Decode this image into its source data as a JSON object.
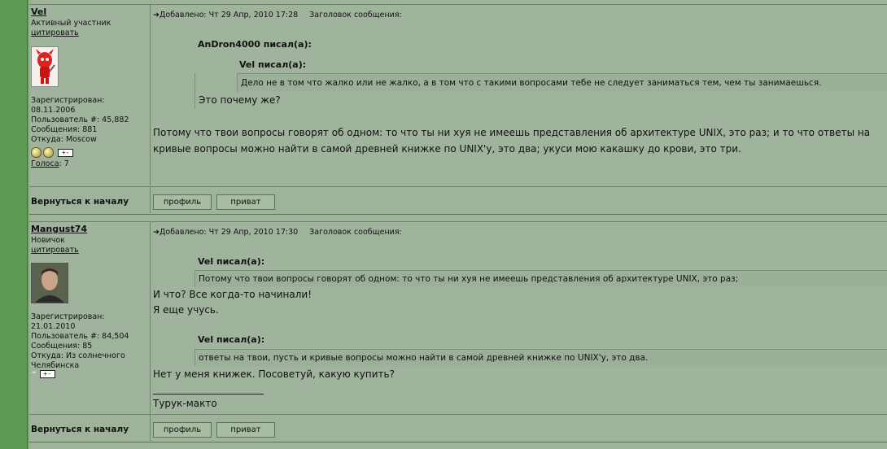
{
  "posts": [
    {
      "author": "Vel",
      "rank": "Активный участник",
      "quote_link": "цитировать",
      "registered_label": "Зарегистрирован:",
      "registered_date": "08.11.2006",
      "user_no": "Пользователь #: 45,882",
      "messages": "Сообщения: 881",
      "from": "Откуда: Moscow",
      "votes_label": "Голоса",
      "votes_value": ": 7",
      "header_added": "Добавлено: Чт 29 Апр, 2010 17:28",
      "header_subject": "Заголовок сообщения:",
      "quote1_author": "AnDron4000 писал(а):",
      "quote2_author": "Vel писал(а):",
      "quote2_text": "Дело не в том что жалко или не жалко, а в том что с такими вопросами тебе не следует заниматься тем, чем ты занимаешься.",
      "quote1_text": "Это почему же?",
      "text_line1": "Потому что твои вопросы говорят об одном: то что ты ни хуя не имеешь представления об архитектуре UNIX, это раз; и то что ответы на",
      "text_line2": "кривые вопросы можно найти в самой древней книжке по UNIX'у, это два; укуси мою какашку до крови, это три."
    },
    {
      "author": "Mangust74",
      "rank": "Новичок",
      "quote_link": "цитировать",
      "registered_label": "Зарегистрирован:",
      "registered_date": "21.01.2010",
      "user_no": "Пользователь #: 84,504",
      "messages": "Сообщения: 85",
      "from": "Откуда: Из солнечного",
      "from2": "Челябинска",
      "header_added": "Добавлено: Чт 29 Апр, 2010 17:30",
      "header_subject": "Заголовок сообщения:",
      "quote1_author": "Vel писал(а):",
      "quote1_text": "Потому что твои вопросы говорят об одном: то что ты ни хуя не имеешь представления об архитектуре UNIX, это раз;",
      "text1": "И что? Все когда-то начинали!",
      "text2": "Я еще учусь.",
      "quote2_author": "Vel писал(а):",
      "quote2_text": "ответы на твои, пусть и кривые вопросы можно найти в самой древней книжке по UNIX'у, это два.",
      "text3": "Нет у меня книжек. Посоветуй, какую купить?",
      "signature_sep": "_________________",
      "signature": "Турук-макто"
    }
  ],
  "footer": {
    "back_label": "Вернуться к началу",
    "profile_button": "профиль",
    "pm_button": "приват"
  },
  "icons": {
    "post_arrow": "➔",
    "plus_minus": "+-"
  }
}
